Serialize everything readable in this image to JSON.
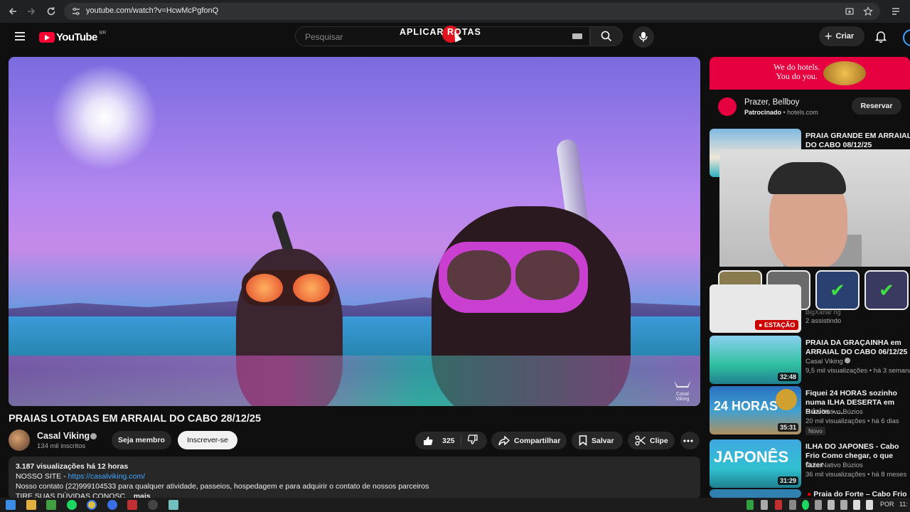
{
  "browser": {
    "url": "youtube.com/watch?v=HcwMcPgfonQ"
  },
  "header": {
    "logo_text": "YouTube",
    "country_code": "BR",
    "search_placeholder": "Pesquisar",
    "overlay_text": "APLICAR ROTAS",
    "create_label": "Criar"
  },
  "video": {
    "title": "PRAIAS LOTADAS EM ARRAIAL DO CABO 28/12/25",
    "watermark": "Casal Viking"
  },
  "channel": {
    "name": "Casal Viking",
    "subscribers": "134 mil inscritos",
    "member_label": "Seja membro",
    "subscribe_label": "Inscrever-se"
  },
  "actions": {
    "likes": "325",
    "share_label": "Compartilhar",
    "save_label": "Salvar",
    "clip_label": "Clipe"
  },
  "description": {
    "stats": "3.187 visualizações  há 12 horas",
    "site_prefix": "NOSSO SITE - ",
    "site_link": "https://casalviking.com/",
    "contact": "Nosso contato (22)999104533 para qualquer atividade, passeios, hospedagem e para adquirir o contato de nossos parceiros",
    "cut_line": "TIRE SUAS DÚVIDAS CONOSC...",
    "more": "mais"
  },
  "ad": {
    "slogan_line1": "We do hotels.",
    "slogan_line2": "You do you.",
    "title": "Prazer, Bellboy",
    "sponsored": "Patrocinado",
    "domain": "hotels.com",
    "button": "Reservar"
  },
  "recommendations": [
    {
      "title": "PRAIA GRANDE EM ARRAIAL DO CABO 08/12/25",
      "channel": "",
      "views": "",
      "duration": ""
    },
    {
      "title": "PRAIA DA GRAÇAINHA em ARRAIAL DO CABO 06/12/25",
      "channel": "Casal Viking",
      "views": "9,5 mil visualizações • há 3 semanas",
      "duration": "32:48"
    },
    {
      "title": "Fiquei 24 HORAS sozinho numa ILHA DESERTA em Búzios - ...",
      "channel": "Guia Nativo Búzios",
      "views": "20 mil visualizações • há 6 dias",
      "duration": "35:31",
      "badge": "Novo"
    },
    {
      "title": "ILHA DO JAPONES - Cabo Frio Como chegar, o que fazer",
      "channel": "Guia Nativo Búzios",
      "views": "36 mil visualizações • há 8 meses",
      "duration": "31:29"
    },
    {
      "title": "Praia do Forte – Cabo Frio",
      "channel": "",
      "views": "",
      "duration": ""
    }
  ],
  "live": {
    "badge": "ESTAÇÃO",
    "watching": "2 assistindo",
    "channel_partial": "BigXanar rig"
  },
  "taskbar": {
    "lang": "POR",
    "time": "11:"
  },
  "colors": {
    "accent": "#ff0033",
    "link": "#3ea6ff",
    "ad_red": "#e6003f"
  }
}
